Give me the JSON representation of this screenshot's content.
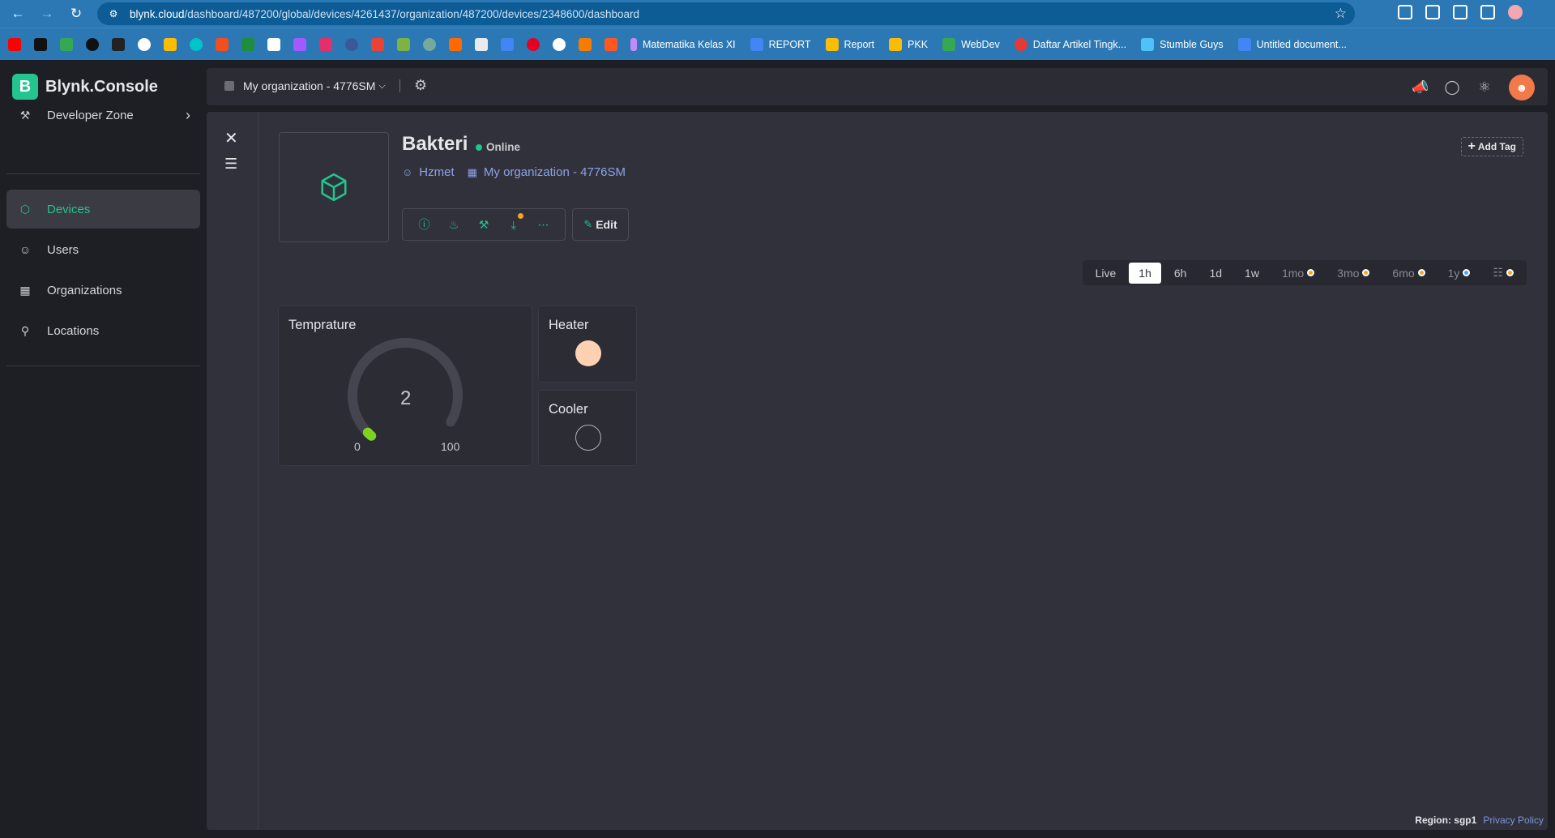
{
  "browser": {
    "url_host": "blynk.cloud",
    "url_path": "/dashboard/487200/global/devices/4261437/organization/487200/devices/2348600/dashboard",
    "bookmarks": [
      "Matematika Kelas XI",
      "REPORT",
      "Report",
      "PKK",
      "WebDev",
      "Daftar Artikel Tingk...",
      "Stumble Guys",
      "Untitled document..."
    ]
  },
  "app": {
    "logo_text": "Blynk.Console",
    "sidebar": [
      {
        "label": "Developer Zone",
        "icon": "tools-icon"
      },
      {
        "label": "Devices",
        "icon": "cube-icon",
        "active": true
      },
      {
        "label": "Users",
        "icon": "users-icon"
      },
      {
        "label": "Organizations",
        "icon": "building-icon"
      },
      {
        "label": "Locations",
        "icon": "pin-icon"
      }
    ],
    "header": {
      "org_name": "My organization - 4776SM"
    }
  },
  "device": {
    "name": "Bakteri",
    "status": "Online",
    "owner": "Hzmet",
    "org": "My organization - 4776SM",
    "edit_label": "Edit",
    "add_tag_label": "Add Tag"
  },
  "time_ranges": [
    {
      "label": "Live"
    },
    {
      "label": "1h",
      "active": true
    },
    {
      "label": "6h"
    },
    {
      "label": "1d"
    },
    {
      "label": "1w"
    },
    {
      "label": "1mo",
      "dot": "orange"
    },
    {
      "label": "3mo",
      "dot": "orange"
    },
    {
      "label": "6mo",
      "dot": "orange"
    },
    {
      "label": "1y",
      "dot": "blue"
    }
  ],
  "widgets": {
    "gauge": {
      "title": "Temprature",
      "value": "2",
      "min": "0",
      "max": "100",
      "value_num": 2,
      "min_num": 0,
      "max_num": 100,
      "color": "#7ed321"
    },
    "heater": {
      "title": "Heater",
      "state": "on",
      "color": "#ffd1b3"
    },
    "cooler": {
      "title": "Cooler",
      "state": "off"
    }
  },
  "footer": {
    "region": "Region: sgp1",
    "privacy": "Privacy Policy"
  },
  "colors": {
    "accent": "#23c48e",
    "link": "#8da3e8",
    "warning": "#f5a623"
  }
}
